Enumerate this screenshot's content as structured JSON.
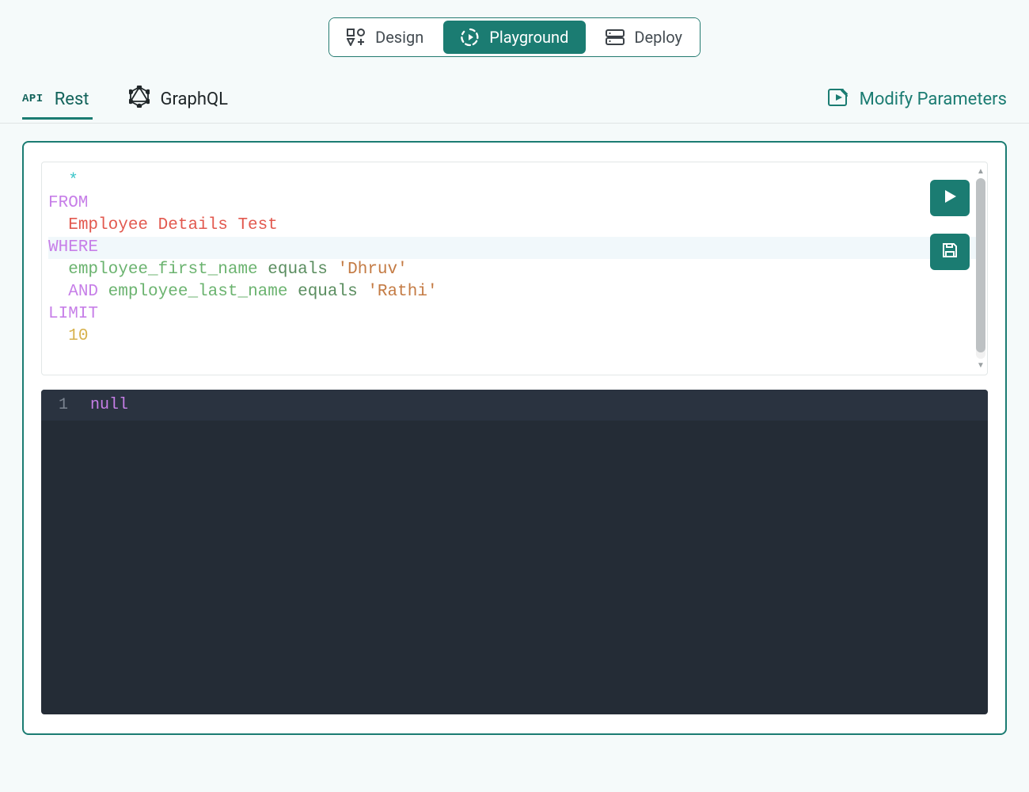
{
  "topTabs": {
    "design": "Design",
    "playground": "Playground",
    "deploy": "Deploy",
    "active": "playground"
  },
  "apiTabs": {
    "restBadge": "API",
    "rest": "Rest",
    "graphql": "GraphQL",
    "active": "rest"
  },
  "actions": {
    "modifyParameters": "Modify Parameters"
  },
  "query": {
    "indent": "  ",
    "star": "*",
    "from": "FROM",
    "table": "Employee Details Test",
    "where": "WHERE",
    "cond1_col": "employee_first_name",
    "cond1_op": "equals",
    "cond1_val": "'Dhruv'",
    "and": "AND",
    "cond2_col": "employee_last_name",
    "cond2_op": "equals",
    "cond2_val": "'Rathi'",
    "limit": "LIMIT",
    "limit_val": "10"
  },
  "output": {
    "lineNo": "1",
    "value": "null"
  },
  "colors": {
    "teal": "#1b7c72",
    "bg": "#f5fafa"
  }
}
